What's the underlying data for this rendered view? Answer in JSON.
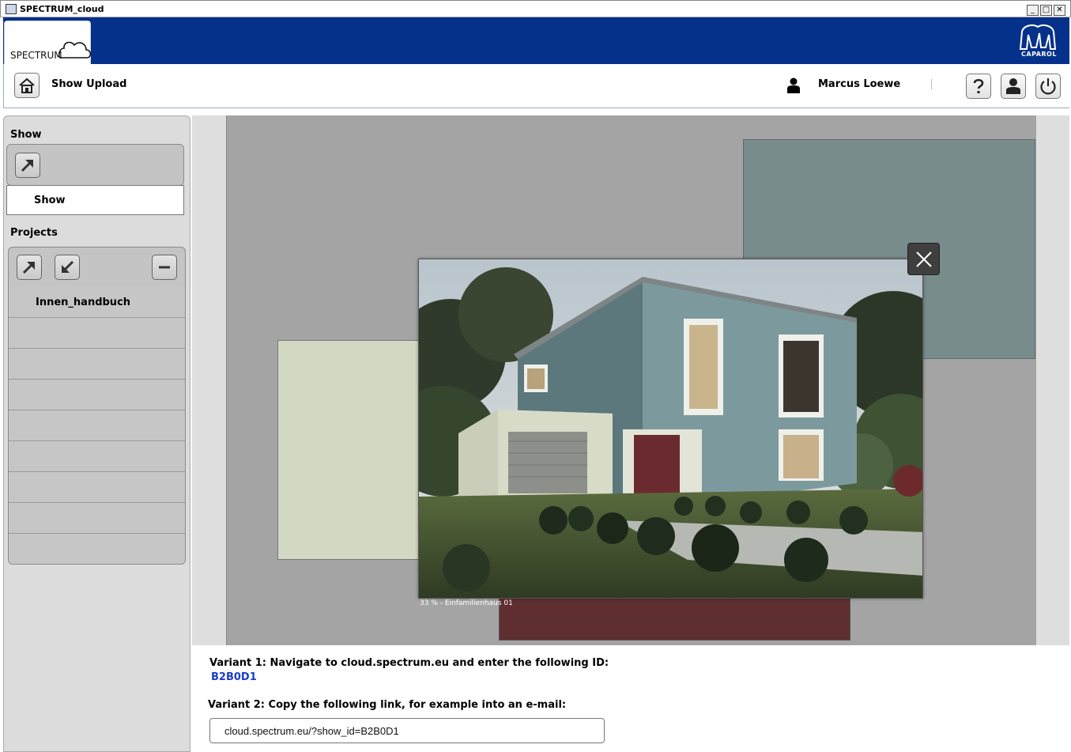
{
  "window": {
    "title": "SPECTRUM_cloud",
    "minimize": "_",
    "maximize": "□",
    "close": "✕"
  },
  "brand": {
    "tab_label": "SPECTRUM",
    "logo_text": "CAPAROL"
  },
  "toolbar": {
    "title": "Show Upload",
    "user_name": "Marcus Loewe"
  },
  "sidebar": {
    "show_label": "Show",
    "show_item": "Show",
    "projects_label": "Projects",
    "projects": [
      "Innen_handbuch",
      "",
      "",
      "",
      "",
      "",
      "",
      "",
      ""
    ]
  },
  "viewer": {
    "caption": "33 %   -     Einfamilienhaus 01"
  },
  "share": {
    "variant1": "Variant 1: Navigate to cloud.spectrum.eu and enter the following ID:",
    "show_id": "B2B0D1",
    "variant2": "Variant 2: Copy the following link, for example into an e-mail:",
    "link": "cloud.spectrum.eu/?show_id=B2B0D1"
  },
  "colors": {
    "brand_blue": "#05318a",
    "swatch_teal": "#788c8b",
    "swatch_cream": "#d3d8c2",
    "swatch_red": "#5f2e31",
    "id_blue": "#1a3cc8"
  }
}
